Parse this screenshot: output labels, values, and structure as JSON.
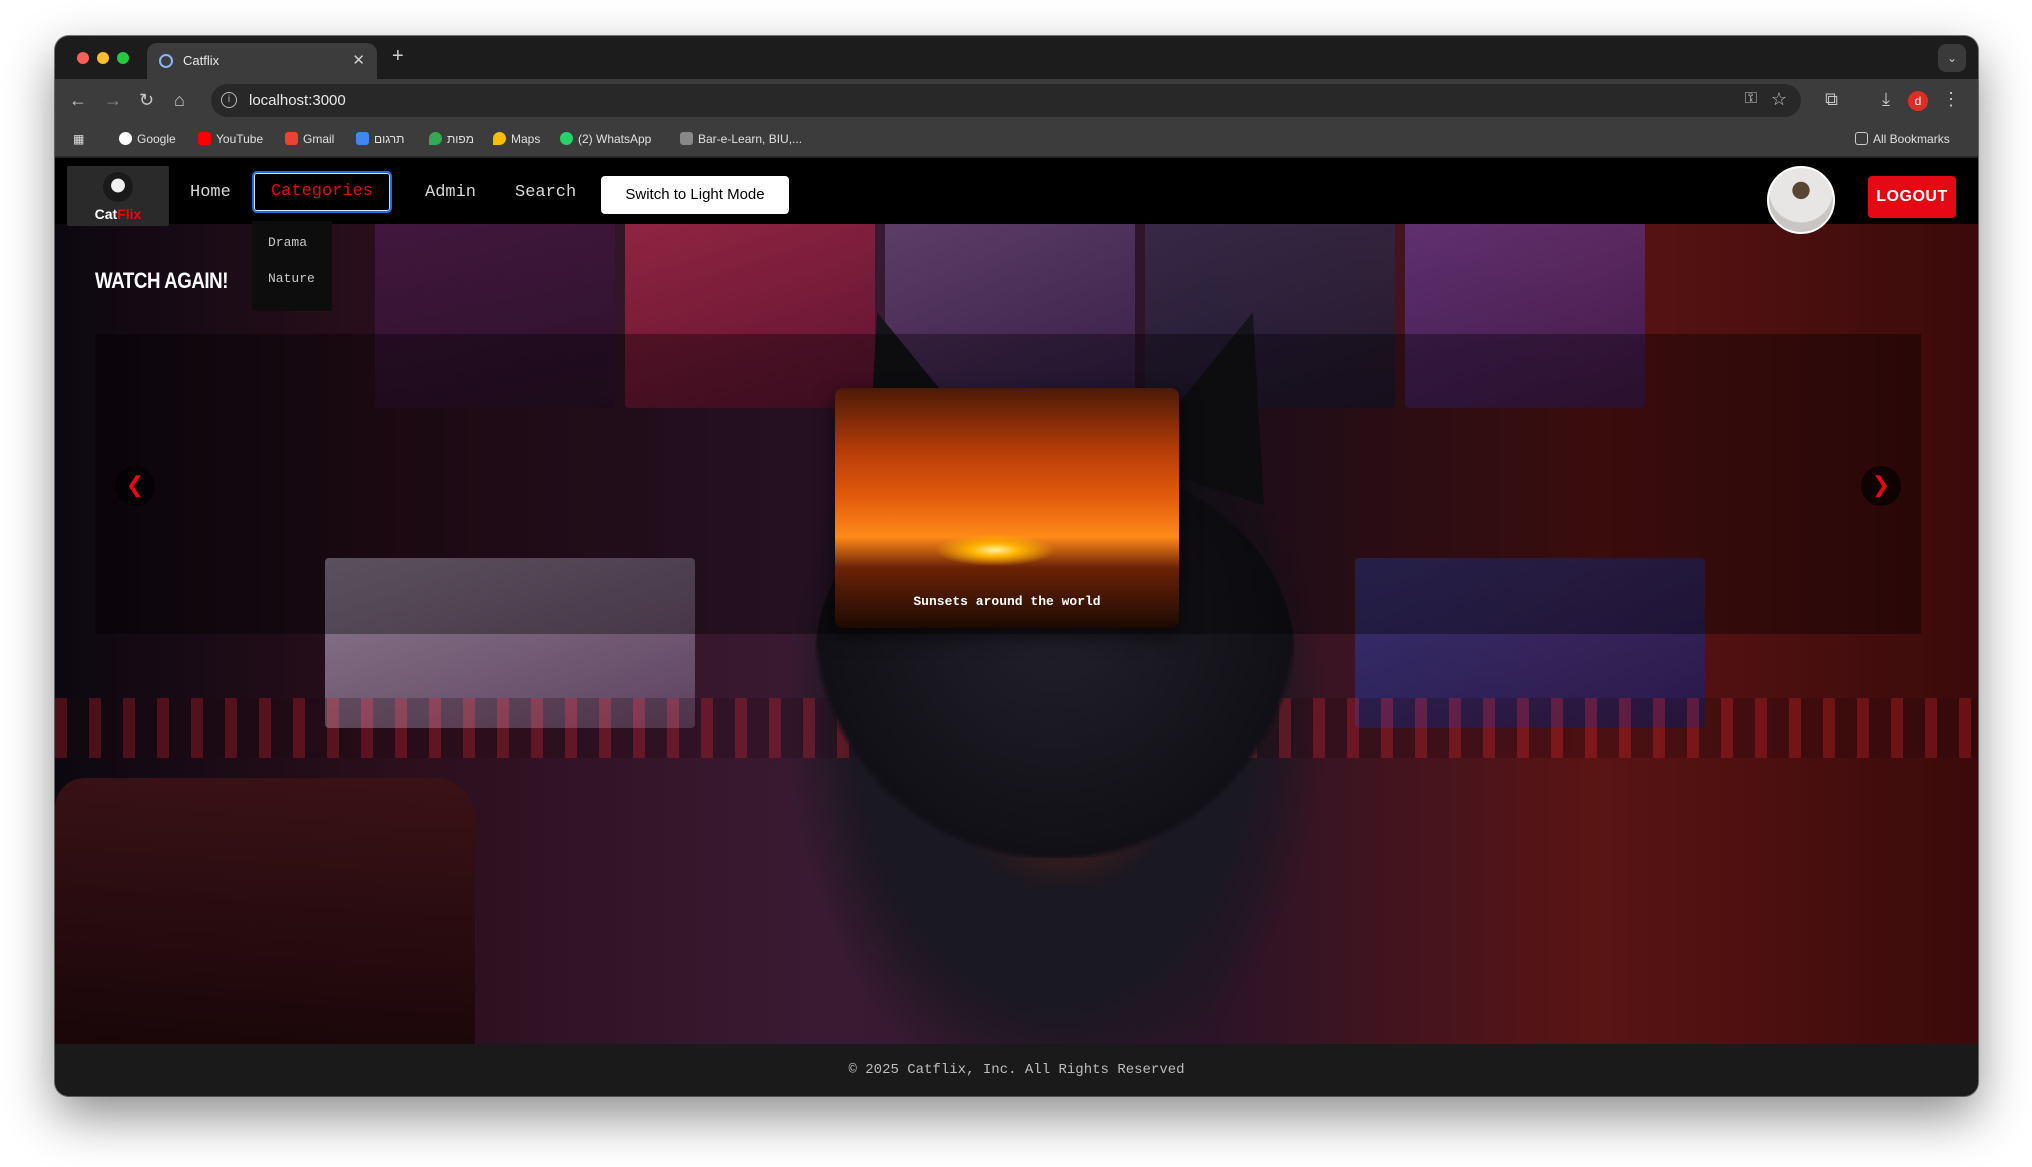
{
  "browser": {
    "tab_title": "Catflix",
    "url": "localhost:3000",
    "bookmarks": [
      "Google",
      "YouTube",
      "Gmail",
      "תרגום",
      "מפות",
      "Maps",
      "(2) WhatsApp",
      "Bar-e-Learn, BIU,..."
    ],
    "all_bookmarks": "All Bookmarks",
    "profile_letter": "d"
  },
  "navbar": {
    "logo_text_a": "Cat",
    "logo_text_b": "Flix",
    "links": [
      "Home",
      "Categories",
      "Admin",
      "Search"
    ],
    "active_link": "Categories",
    "dropdown": [
      "Drama",
      "Nature"
    ],
    "mode_button": "Switch to Light Mode",
    "logout_button": "LOGOUT"
  },
  "main": {
    "section_title": "WATCH AGAIN!",
    "arrow_left": "❮",
    "arrow_right": "❯",
    "movie_caption": "Sunsets around the world"
  },
  "footer": {
    "text": "© 2025 Catflix, Inc. All Rights Reserved"
  },
  "colors": {
    "accent": "#e50914",
    "focus_outline": "#1f6fe0"
  }
}
